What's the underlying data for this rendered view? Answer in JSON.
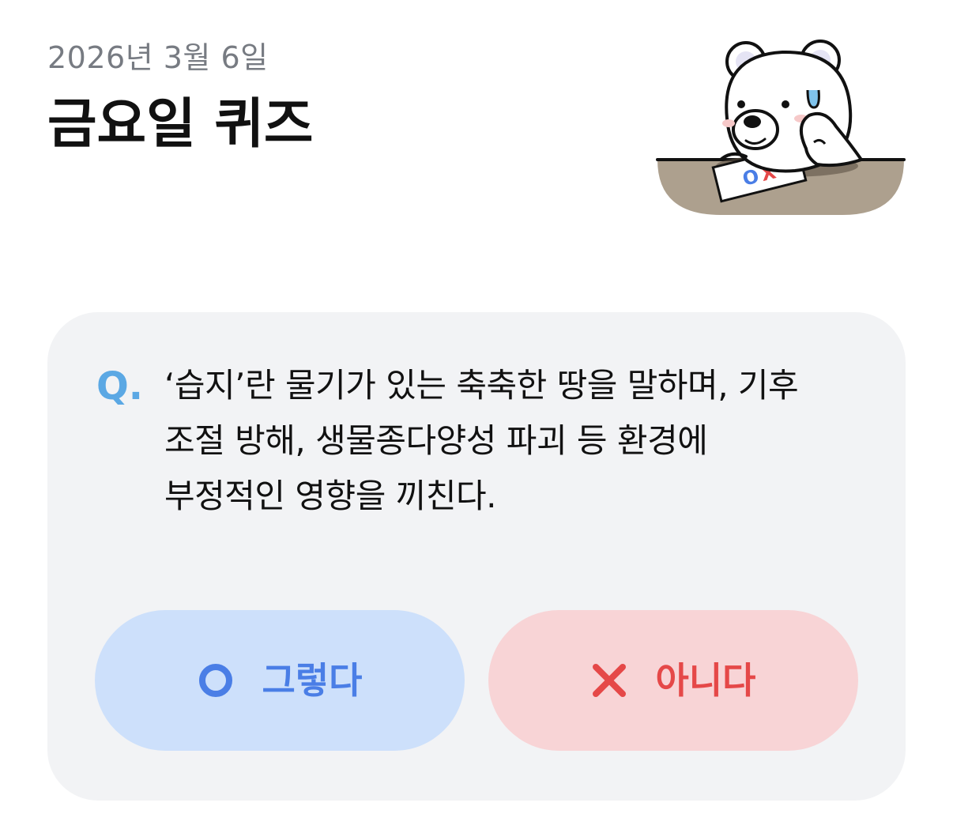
{
  "header": {
    "date": "2026년 3월 6일",
    "title": "금요일 퀴즈"
  },
  "mascot": {
    "icon": "polar-bear-thinking-icon",
    "sheet_mark_o": "O",
    "sheet_mark_x": "X"
  },
  "quiz": {
    "q_label": "Q.",
    "question_lines": [
      "‘습지’란 물기가 있는 축축한 땅을 말하며, 기후",
      "조절 방해, 생물종다양성 파괴 등 환경에",
      "부정적인 영향을 끼친다."
    ],
    "yes_label": "그렇다",
    "yes_icon": "circle-o-icon",
    "no_label": "아니다",
    "no_icon": "cross-x-icon"
  },
  "colors": {
    "card_bg": "#f2f3f5",
    "q_accent": "#5ba8e4",
    "yes_bg": "#cde0fb",
    "yes_fg": "#4a7ee6",
    "no_bg": "#f8d4d6",
    "no_fg": "#e54848"
  }
}
